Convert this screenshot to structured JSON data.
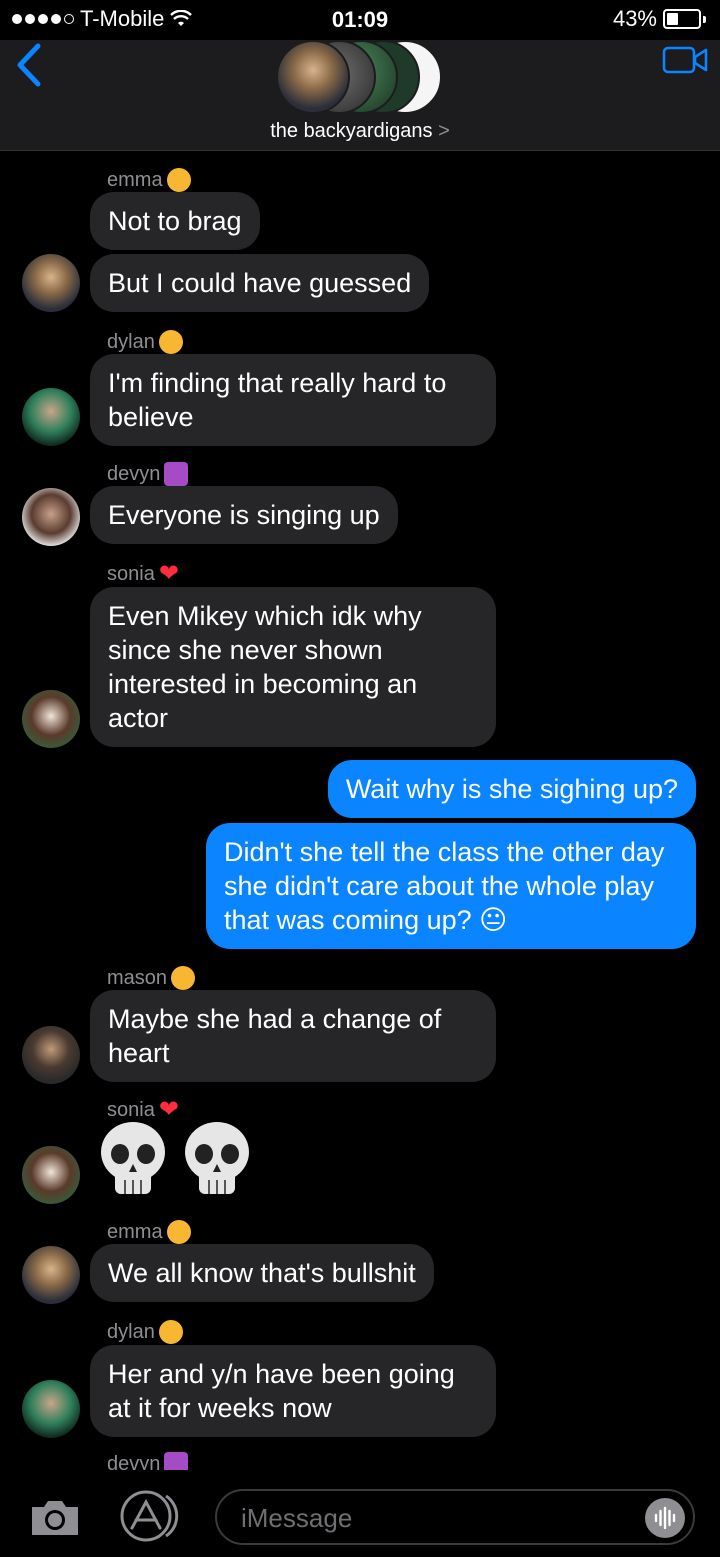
{
  "status_bar": {
    "carrier": "T-Mobile",
    "time": "01:09",
    "battery_percent": "43%",
    "battery_level": 0.43
  },
  "header": {
    "group_name": "the backyardigans",
    "chevron": ">"
  },
  "messages": [
    {
      "sender": "emma",
      "text": "Not to brag"
    },
    {
      "text": "But I could have guessed"
    },
    {
      "sender": "dylan",
      "text": "I'm finding that really hard to believe"
    },
    {
      "sender": "devyn",
      "text": "Everyone is singing up"
    },
    {
      "sender": "sonia",
      "text": "Even Mikey which idk why since she never shown interested in becoming an actor"
    },
    {
      "text": "Wait why is she sighing up?"
    },
    {
      "text": "Didn't she tell the class the other day she didn't care about the whole play that was coming up? 😐"
    },
    {
      "sender": "mason",
      "text": "Maybe she had a change of heart"
    },
    {
      "sender": "sonia",
      "text": "💀 💀"
    },
    {
      "sender": "emma",
      "text": "We all know that's bullshit"
    },
    {
      "sender": "dylan",
      "text": "Her and y/n have been going at it for weeks now"
    },
    {
      "sender": "devyn"
    }
  ],
  "input": {
    "placeholder": "iMessage"
  },
  "colors": {
    "incoming_bubble": "#262628",
    "outgoing_bubble": "#0a84ff",
    "accent": "#0a84ff"
  },
  "icons": [
    "back-chevron-icon",
    "video-camera-icon",
    "camera-icon",
    "app-store-icon",
    "audio-waveform-icon"
  ]
}
